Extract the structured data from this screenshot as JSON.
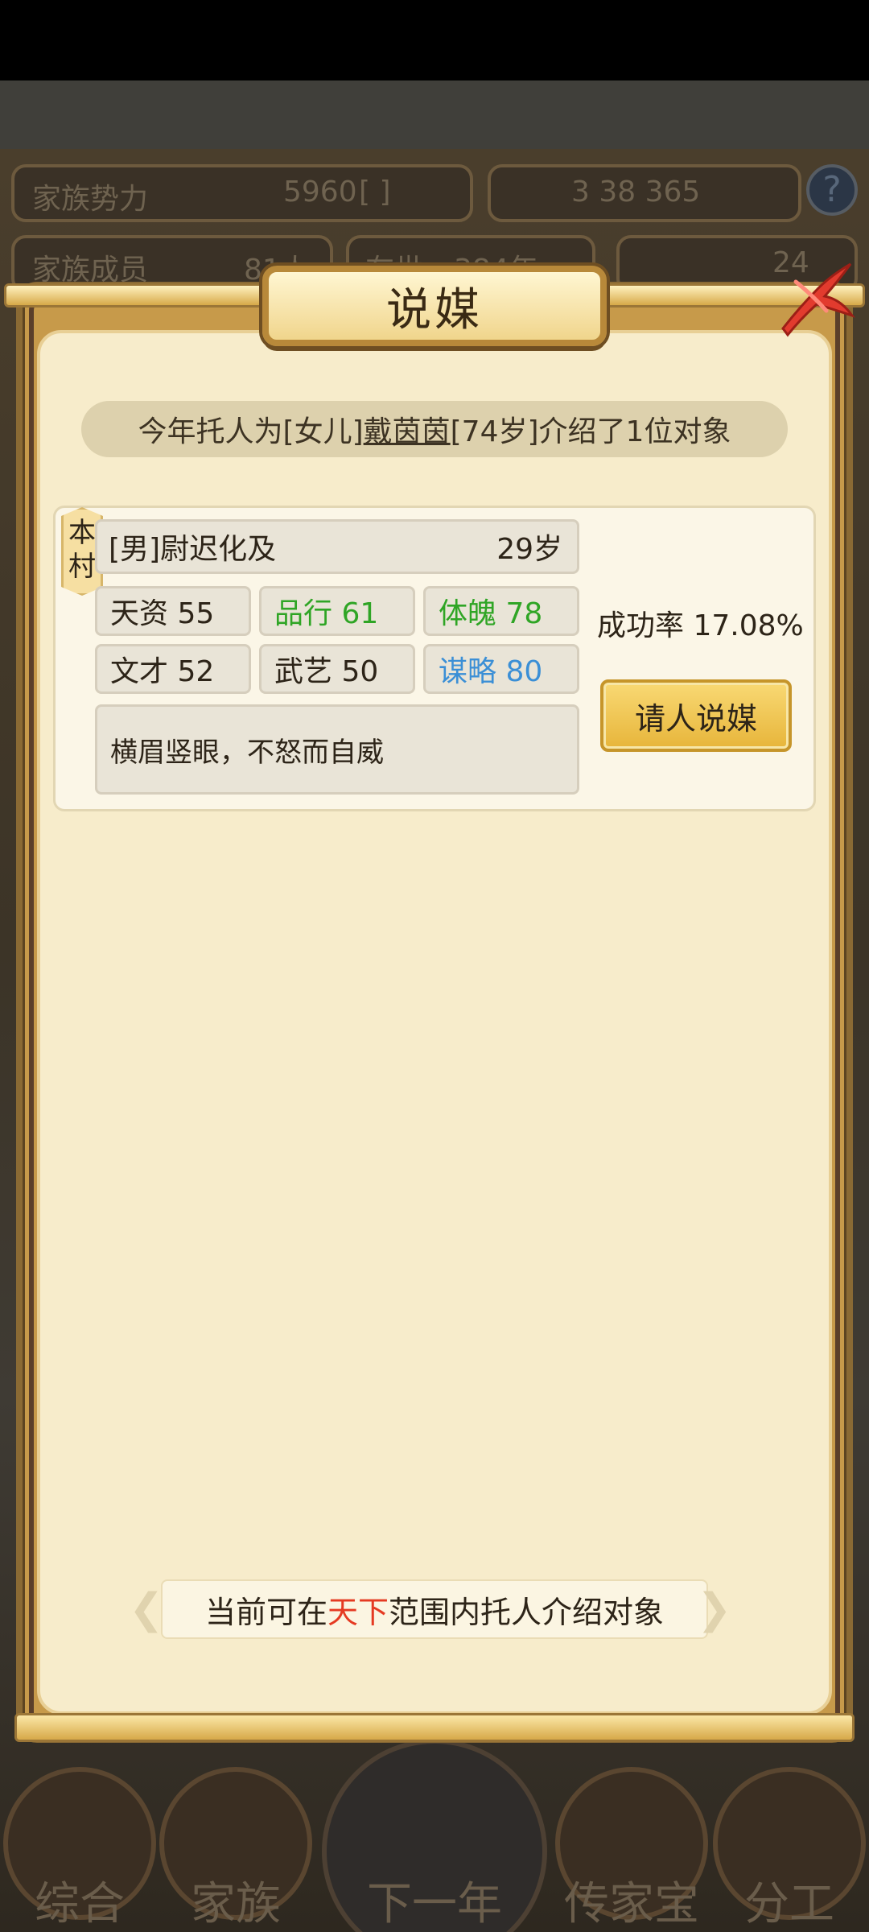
{
  "background": {
    "resources": {
      "clan_power_label": "家族势力",
      "clan_power_value": "5960",
      "clan_rank_text": "[ ]",
      "currency_text": "3   38   365",
      "members_label": "家族成员",
      "members_value": "81人",
      "generation_label": "在世",
      "generation_value": "384年",
      "gold_value": "24"
    },
    "help_icon": "?",
    "nav": {
      "general": "综合",
      "family": "家族",
      "next_year": "下一年",
      "heirloom": "传家宝",
      "assign": "分工"
    }
  },
  "modal": {
    "title": "说媒",
    "close_icon": "close-icon",
    "notice": {
      "prefix": "今年托人为[女儿]",
      "name": "戴茵茵",
      "suffix": "[74岁]介绍了1位对象"
    },
    "candidate": {
      "origin_tag": "本\n村",
      "name": "[男]尉迟化及",
      "age": "29岁",
      "stats": [
        {
          "label": "天资 55",
          "color": "#2d2418"
        },
        {
          "label": "品行 61",
          "color": "#2fa525"
        },
        {
          "label": "体魄 78",
          "color": "#2fa525"
        },
        {
          "label": "文才 52",
          "color": "#2d2418"
        },
        {
          "label": "武艺 50",
          "color": "#2d2418"
        },
        {
          "label": "谋略 80",
          "color": "#3b8fd6"
        }
      ],
      "description": "横眉竖眼，不怒而自威",
      "success_rate": "成功率 17.08%",
      "action_label": "请人说媒"
    },
    "footer": {
      "prefix": "当前可在",
      "highlight": "天下",
      "suffix": "范围内托人介绍对象",
      "highlight_color": "#e53a22"
    }
  }
}
